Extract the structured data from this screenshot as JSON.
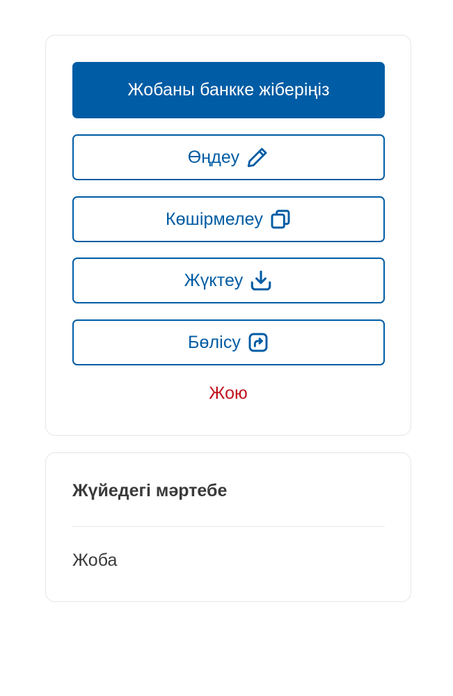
{
  "actions": {
    "submit_label": "Жобаны банкке жіберіңіз",
    "edit_label": "Өңдеу",
    "copy_label": "Көшірмелеу",
    "download_label": "Жүктеу",
    "share_label": "Бөлісу",
    "delete_label": "Жою",
    "icons": {
      "edit": "pencil-icon",
      "copy": "copy-icon",
      "download": "download-icon",
      "share": "share-icon"
    }
  },
  "status": {
    "label": "Жүйедегі мәртебе",
    "value": "Жоба"
  },
  "colors": {
    "primary": "#005ca4",
    "danger": "#c0141c",
    "text": "#3a3a3a",
    "border": "#e3e6ea"
  }
}
